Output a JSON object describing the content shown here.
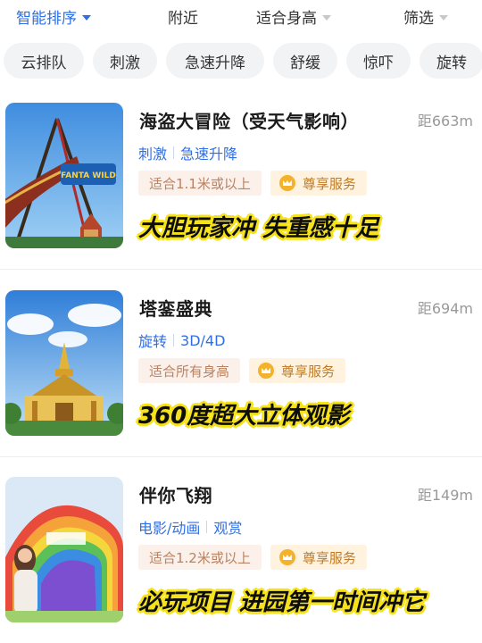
{
  "sort_bar": [
    {
      "label": "智能排序",
      "active": true
    },
    {
      "label": "附近",
      "active": false
    },
    {
      "label": "适合身高",
      "active": false
    },
    {
      "label": "筛选",
      "active": false
    }
  ],
  "chips": [
    "云排队",
    "刺激",
    "急速升降",
    "舒缓",
    "惊吓",
    "旋转"
  ],
  "attractions": [
    {
      "title": "海盗大冒险（受天气影响）",
      "distance": "距663m",
      "tags": [
        "刺激",
        "急速升降"
      ],
      "height_badge": "适合1.1米或以上",
      "vip_badge": "尊享服务",
      "slogan": "大胆玩家冲 失重感十足",
      "thumb_text": "FANTA WILD"
    },
    {
      "title": "塔銮盛典",
      "distance": "距694m",
      "tags": [
        "旋转",
        "3D/4D"
      ],
      "height_badge": "适合所有身高",
      "vip_badge": "尊享服务",
      "slogan": "360度超大立体观影"
    },
    {
      "title": "伴你飞翔",
      "distance": "距149m",
      "tags": [
        "电影/动画",
        "观赏"
      ],
      "height_badge": "适合1.2米或以上",
      "vip_badge": "尊享服务",
      "slogan": "必玩项目 进园第一时间冲它"
    }
  ],
  "colors": {
    "accent": "#2f6fe4",
    "slogan_highlight": "#f6e21a",
    "height_badge_bg": "#fbf1ea",
    "vip_badge_bg": "#fff3e0"
  },
  "icons": {
    "sort_caret": "chevron-down-icon",
    "vip": "crown-icon"
  }
}
